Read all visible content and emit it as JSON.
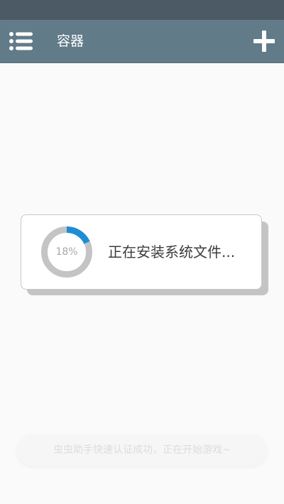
{
  "app_bar": {
    "title": "容器",
    "menu_icon": "list-menu-icon",
    "add_icon": "plus-icon"
  },
  "progress_dialog": {
    "percent_label": "18%",
    "progress": 0.18,
    "message": "正在安装系统文件..."
  },
  "toast": {
    "message": "虫虫助手快速认证成功，正在开始游戏~"
  },
  "colors": {
    "status_bar": "#4b5a64",
    "app_bar": "#617b88",
    "ring_track": "#c4c4c4",
    "ring_progress": "#1f8dd6",
    "background": "#fafafa"
  }
}
